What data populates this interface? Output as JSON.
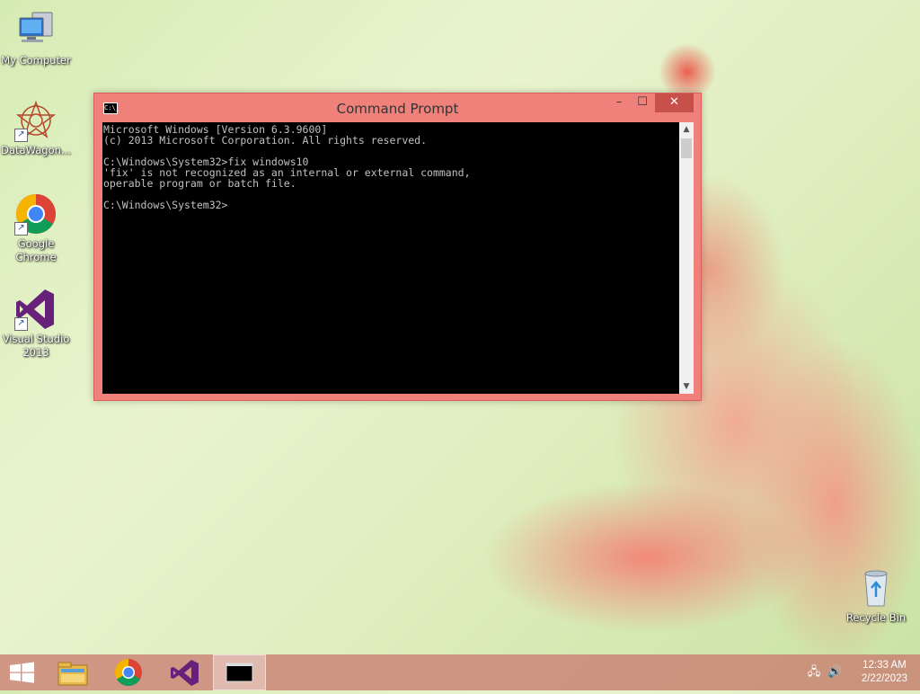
{
  "desktop": {
    "icons": [
      {
        "label": "My Computer",
        "icon": "computer-icon"
      },
      {
        "label": "DataWagon...",
        "icon": "datawagon-icon"
      },
      {
        "label": "Google Chrome",
        "icon": "chrome-icon"
      },
      {
        "label": "Visual Studio 2013",
        "icon": "visual-studio-icon"
      },
      {
        "label": "Recycle Bin",
        "icon": "recycle-bin-icon"
      }
    ]
  },
  "window": {
    "title": "Command Prompt",
    "icon": "cmd-icon",
    "title_icon_text": "C:\\_",
    "minimize": "–",
    "maximize": "☐",
    "close": "✕",
    "console_lines": [
      "Microsoft Windows [Version 6.3.9600]",
      "(c) 2013 Microsoft Corporation. All rights reserved.",
      "",
      "C:\\Windows\\System32>fix windows10",
      "'fix' is not recognized as an internal or external command,",
      "operable program or batch file.",
      "",
      "C:\\Windows\\System32>"
    ],
    "scroll_up": "▲",
    "scroll_down": "▼"
  },
  "taskbar": {
    "items": [
      {
        "icon": "start-icon"
      },
      {
        "icon": "file-explorer-icon"
      },
      {
        "icon": "chrome-icon"
      },
      {
        "icon": "visual-studio-icon"
      },
      {
        "icon": "cmd-icon",
        "label": "C:\\_",
        "active": true
      }
    ],
    "tray": {
      "network_icon": "network-icon",
      "volume_icon": "volume-icon",
      "network_glyph": "🖧",
      "volume_glyph": "🔊",
      "time": "12:33 AM",
      "date": "2/22/2023"
    }
  },
  "colors": {
    "window_frame": "#f0817a",
    "close_button": "#c7504b",
    "console_bg": "#000000",
    "console_text": "#c0c0c0"
  }
}
